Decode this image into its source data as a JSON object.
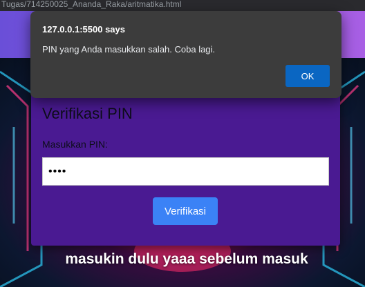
{
  "browser": {
    "url_fragment": "Tugas/714250025_Ananda_Raka/aritmatika.html"
  },
  "alert": {
    "origin": "127.0.0.1:5500 says",
    "message": "PIN yang Anda masukkan salah. Coba lagi.",
    "ok_label": "OK"
  },
  "pin_form": {
    "title": "Verifikasi PIN",
    "label": "Masukkan PIN:",
    "value": "1234",
    "button_label": "Verifikasi"
  },
  "caption": "masukin dulu yaaa sebelum masuk",
  "colors": {
    "card": "#4a1a92",
    "button": "#3b82f6",
    "alert_bg": "#3c3c3c",
    "alert_button": "#0a66c2"
  }
}
